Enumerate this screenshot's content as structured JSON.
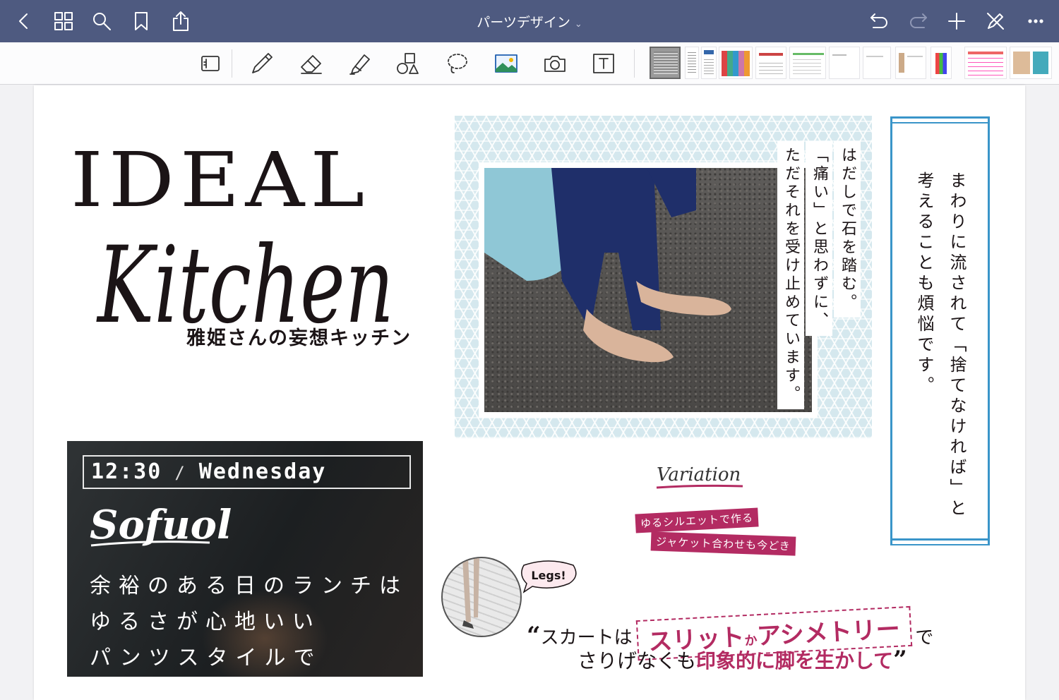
{
  "app": {
    "document_title": "パーツデザイン",
    "accent_color": "#4e5a80"
  },
  "nav": {
    "back_icon": "chevron-left-icon",
    "grid_icon": "grid-icon",
    "search_icon": "search-icon",
    "bookmark_icon": "bookmark-icon",
    "share_icon": "share-icon",
    "undo_icon": "undo-icon",
    "redo_icon": "redo-icon",
    "add_icon": "plus-icon",
    "pen_off_icon": "pen-off-icon",
    "more_icon": "more-icon"
  },
  "tools": [
    "reader-mode-icon",
    "pen-icon",
    "eraser-icon",
    "highlighter-icon",
    "shapes-icon",
    "lasso-icon",
    "image-icon",
    "camera-icon",
    "text-icon"
  ],
  "page": {
    "title_word": "IDEAL",
    "title_script": "Kitchen",
    "subtitle": "雅姫さんの妄想キッチン",
    "lunch_card": {
      "time": "12:30",
      "slash": "/",
      "day": "Wednesday",
      "brand": "Sofuol",
      "line1": "余裕のある日のランチは",
      "line2": "ゆるさが心地いい",
      "line3": "パンツスタイルで"
    },
    "photo_captions": {
      "col1": "はだしで石を踏む。",
      "col2": "「痛い」と思わずに、",
      "col3": "ただそれを受け止めています。"
    },
    "vertical_copy": {
      "col1": "まわりに流されて「捨てなければ」と",
      "col2": "考えることも煩悩です。"
    },
    "variation": {
      "script": "Variation",
      "tag1": "ゆるシルエットで作る",
      "tag2": "ジャケット合わせも今どき"
    },
    "legs_quote": {
      "bubble": "Legs!",
      "open_mark": "“",
      "lead": "スカートは",
      "highlight_a": "スリット",
      "highlight_ka": "か",
      "highlight_b": "アシメトリー",
      "tail": "で",
      "line2_a": "さりげなくも",
      "line2_b": "印象的に脚を生かして",
      "close_mark": "”"
    },
    "brand_color": "#b32b62",
    "frame_color": "#3a95c9"
  }
}
